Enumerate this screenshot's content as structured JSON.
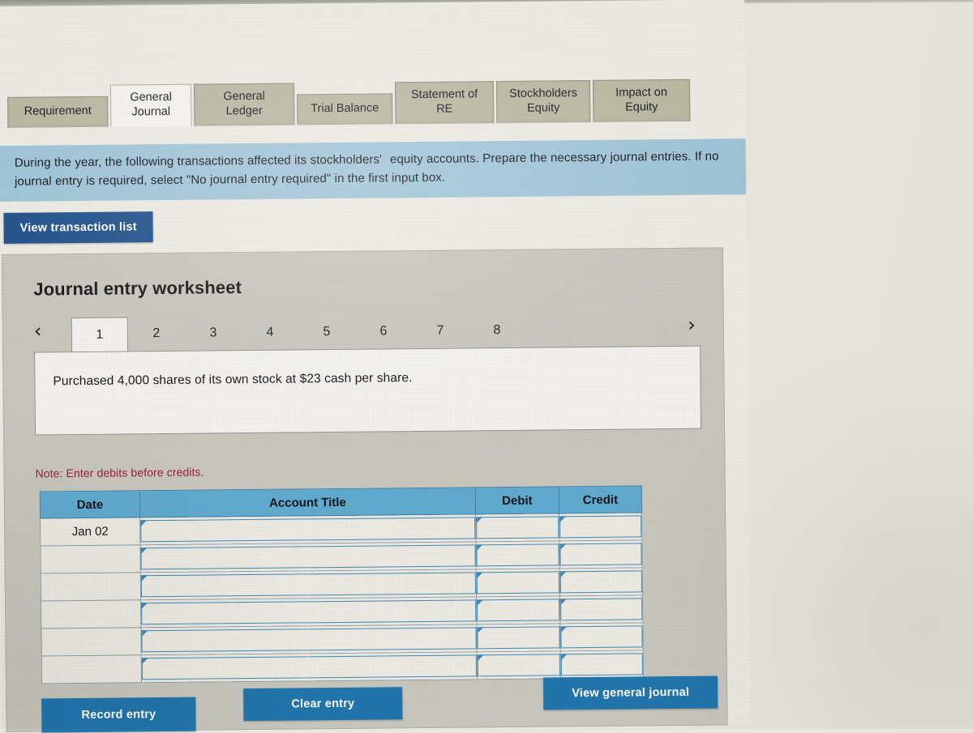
{
  "app": {
    "tabs": [
      {
        "id": "requirement",
        "label": "Requirement",
        "active": false
      },
      {
        "id": "general-journal",
        "label": "General\nJournal",
        "active": true
      },
      {
        "id": "general-ledger",
        "label": "General\nLedger",
        "active": false
      },
      {
        "id": "trial-balance",
        "label": "Trial Balance",
        "active": false
      },
      {
        "id": "statement-of-re",
        "label": "Statement of\nRE",
        "active": false
      },
      {
        "id": "stockholders-equity",
        "label": "Stockholders\nEquity",
        "active": false
      },
      {
        "id": "impact-on-equity",
        "label": "Impact on\nEquity",
        "active": false
      }
    ],
    "instructions": {
      "line1_a": "During the year, the following transactions affected its stockholders'",
      "line1_b": "equity accounts.  Prepare the necessary journal entries.  If no",
      "line2": "journal entry is required, select \"No journal entry required\" in the first input box."
    },
    "view_transaction_list_label": "View transaction list"
  },
  "worksheet": {
    "title": "Journal entry worksheet",
    "pager": {
      "prev_icon": "‹",
      "next_icon": "›",
      "pages": [
        "1",
        "2",
        "3",
        "4",
        "5",
        "6",
        "7",
        "8"
      ],
      "active_page": "1"
    },
    "transaction_text": "Purchased 4,000 shares of its own stock at $23 cash per share.",
    "note": "Note: Enter debits before credits.",
    "table": {
      "columns": [
        "Date",
        "Account Title",
        "Debit",
        "Credit"
      ],
      "rows": [
        {
          "date": "Jan 02",
          "account_title": "",
          "debit": "",
          "credit": ""
        },
        {
          "date": "",
          "account_title": "",
          "debit": "",
          "credit": ""
        },
        {
          "date": "",
          "account_title": "",
          "debit": "",
          "credit": ""
        },
        {
          "date": "",
          "account_title": "",
          "debit": "",
          "credit": ""
        },
        {
          "date": "",
          "account_title": "",
          "debit": "",
          "credit": ""
        },
        {
          "date": "",
          "account_title": "",
          "debit": "",
          "credit": ""
        }
      ]
    },
    "buttons": {
      "record_entry": "Record entry",
      "clear_entry": "Clear entry",
      "view_general_journal": "View general journal"
    }
  },
  "colors": {
    "tab_inactive": "#b6b8a0",
    "tab_active": "#f3f2ee",
    "instruction_band": "#9ec4d6",
    "primary_button": "#1f74ab",
    "nav_button": "#1d4e8a",
    "table_header": "#5fa9cf",
    "note_text": "#9b1d32",
    "panel_background": "#c7c6bd"
  }
}
